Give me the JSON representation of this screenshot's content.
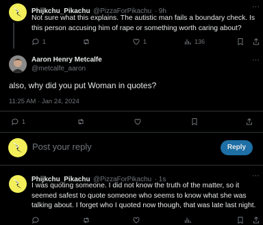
{
  "tweet1": {
    "display_name": "Phijkchu_Pikachu",
    "handle": "@PizzaForPikachu",
    "time": "· 9h",
    "text": "Not sure what this explains. The autistic man fails a boundary check. Is this person accusing him of rape or something worth caring about?",
    "replies": "1",
    "likes": "1",
    "views": "136"
  },
  "main": {
    "display_name": "Aaron Henry Metcalfe",
    "handle": "@metcalfe_aaron",
    "text": "also, why did you put Woman in quotes?",
    "timestamp": "11:25 AM · Jan 24, 2024",
    "replies": "1"
  },
  "composer": {
    "placeholder": "Post your reply",
    "button_label": "Reply"
  },
  "tweet2": {
    "display_name": "Phijkchu_Pikachu",
    "handle": "@PizzaForPikachu",
    "time": "· 1s",
    "text": "I was quoting someone. I did not know the truth of the matter, so it seemed safest to quote someone who seems to know what she was talking about. I forget who I quoted now though, that was late last night."
  },
  "colors": {
    "accent": "#1d9bf0",
    "reply_button_disabled": "#1d6fa5",
    "avatar_yellow": "#f2ef5a"
  }
}
